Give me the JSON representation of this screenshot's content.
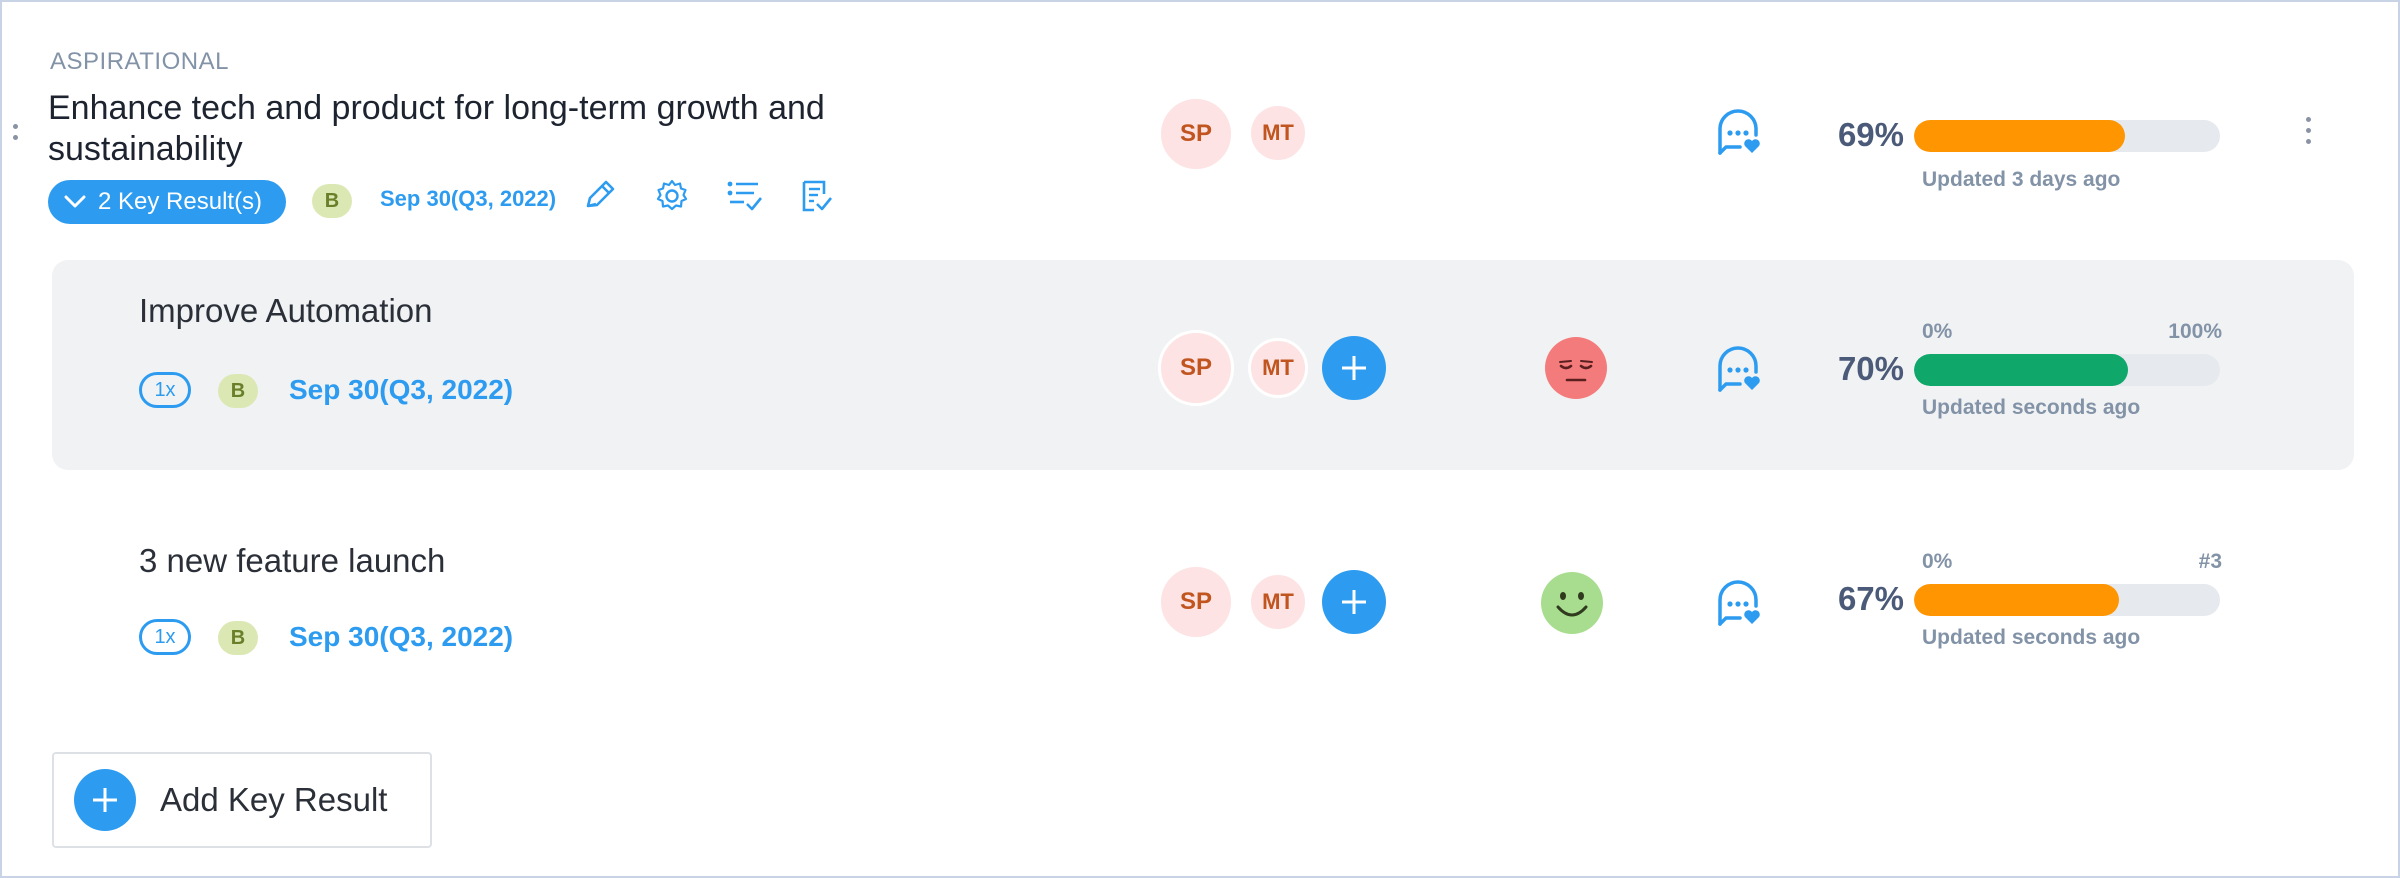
{
  "objective": {
    "category": "ASPIRATIONAL",
    "title": "Enhance tech and product for long-term growth and sustainability",
    "key_results_toggle": "2 Key Result(s)",
    "badge": "B",
    "due_date": "Sep 30(Q3, 2022)",
    "owners": [
      "SP",
      "MT"
    ],
    "progress_text": "69%",
    "progress_fraction": 0.69,
    "progress_color": "#ff9500",
    "updated": "Updated 3 days ago"
  },
  "key_results": [
    {
      "title": "Improve Automation",
      "multiplier": "1x",
      "badge": "B",
      "due_date": "Sep 30(Q3, 2022)",
      "owners": [
        "SP",
        "MT"
      ],
      "mood": "sad",
      "mood_color": "#f47b7b",
      "range_start": "0%",
      "range_end": "100%",
      "progress_text": "70%",
      "progress_fraction": 0.7,
      "progress_color": "#0fa76a",
      "updated": "Updated seconds ago"
    },
    {
      "title": "3 new feature launch",
      "multiplier": "1x",
      "badge": "B",
      "due_date": "Sep 30(Q3, 2022)",
      "owners": [
        "SP",
        "MT"
      ],
      "mood": "happy",
      "mood_color": "#a8dd8f",
      "range_start": "0%",
      "range_end": "#3",
      "progress_text": "67%",
      "progress_fraction": 0.67,
      "progress_color": "#ff9500",
      "updated": "Updated seconds ago"
    }
  ],
  "add_key_result_label": "Add Key Result",
  "colors": {
    "accent": "#2d9cf0",
    "panel": "#f1f2f4"
  }
}
